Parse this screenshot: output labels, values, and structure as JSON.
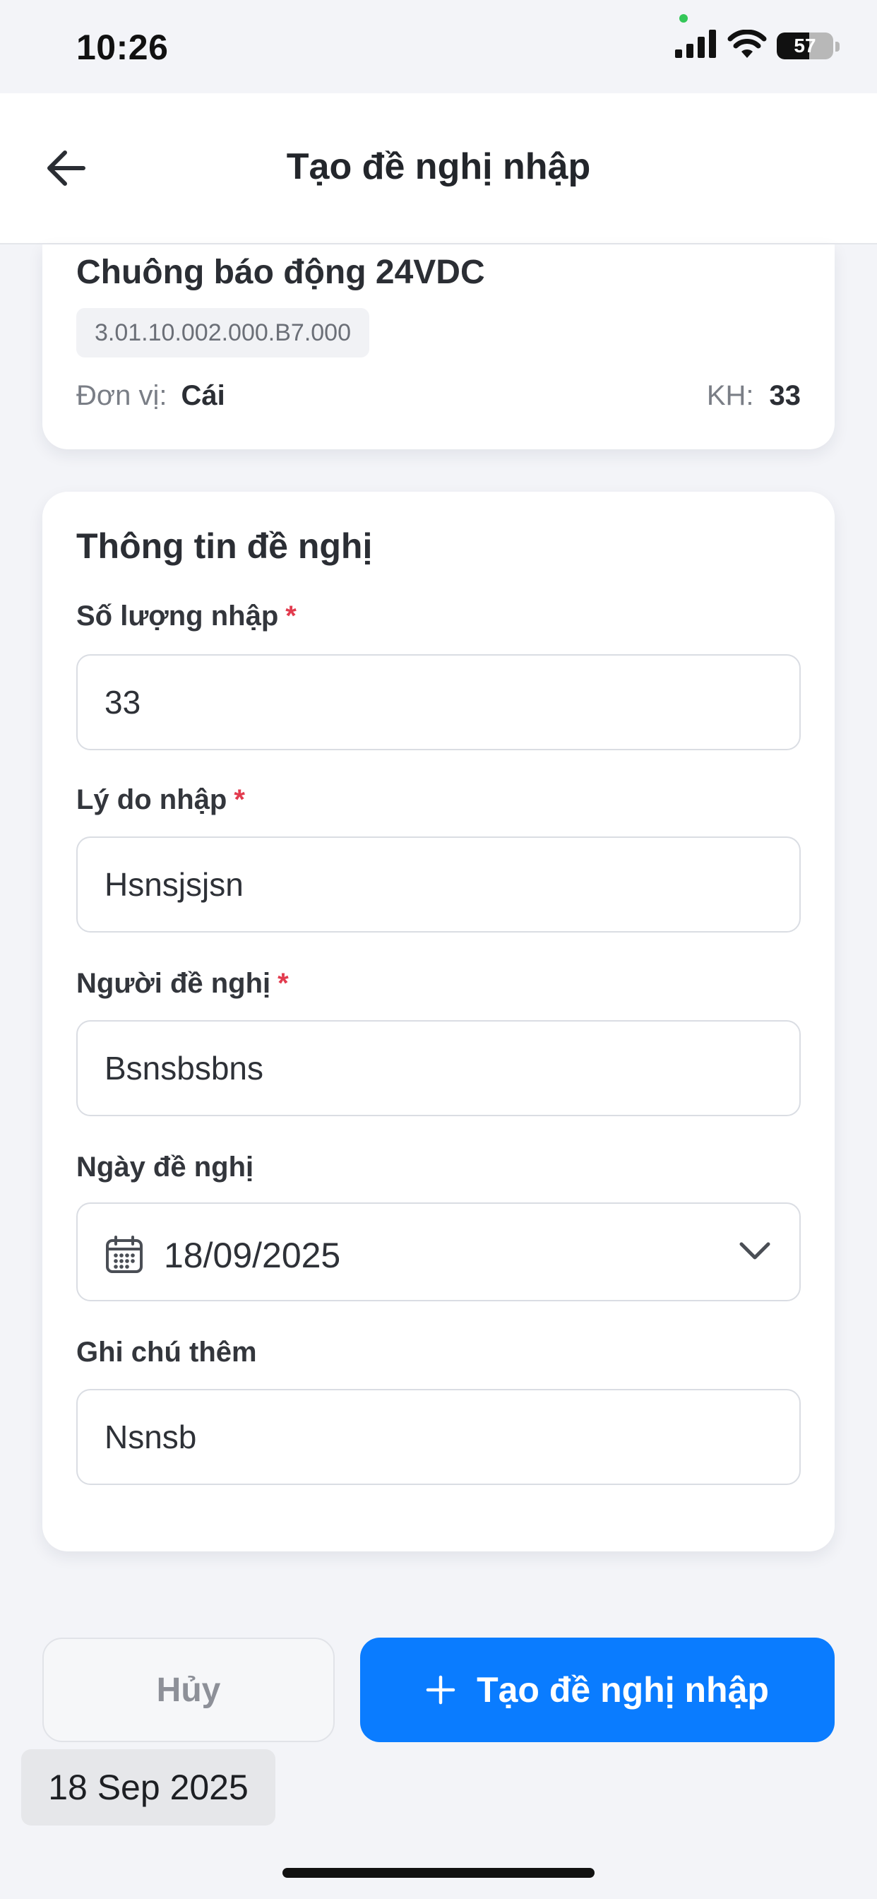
{
  "status_bar": {
    "time": "10:26",
    "battery": "57",
    "icons": [
      "signal-icon",
      "wifi-icon",
      "battery-icon"
    ]
  },
  "header": {
    "back_icon": "arrow-left-icon",
    "title": "Tạo đề nghị nhập"
  },
  "item": {
    "name": "Chuông báo động 24VDC",
    "code": "3.01.10.002.000.B7.000",
    "unit_label": "Đơn vị:",
    "unit_value": "Cái",
    "kh_label": "KH:",
    "kh_value": "33"
  },
  "form": {
    "section_title": "Thông tin đề nghị",
    "required_mark": "*",
    "quantity": {
      "label": "Số lượng nhập",
      "value": "33"
    },
    "reason": {
      "label": "Lý do nhập",
      "value": "Hsnsjsjsn"
    },
    "requester": {
      "label": "Người đề nghị",
      "value": "Bsnsbsbns"
    },
    "date": {
      "label": "Ngày đề nghị",
      "value": "18/09/2025",
      "icon": "calendar-icon"
    },
    "note": {
      "label": "Ghi chú thêm",
      "value": "Nsnsb"
    }
  },
  "actions": {
    "cancel_label": "Hủy",
    "submit_label": "Tạo đề nghị nhập",
    "submit_icon": "plus-icon"
  },
  "date_badge": "18 Sep 2025",
  "colors": {
    "accent": "#0a7cff",
    "required": "#e23b4e",
    "background": "#f3f4f8"
  }
}
